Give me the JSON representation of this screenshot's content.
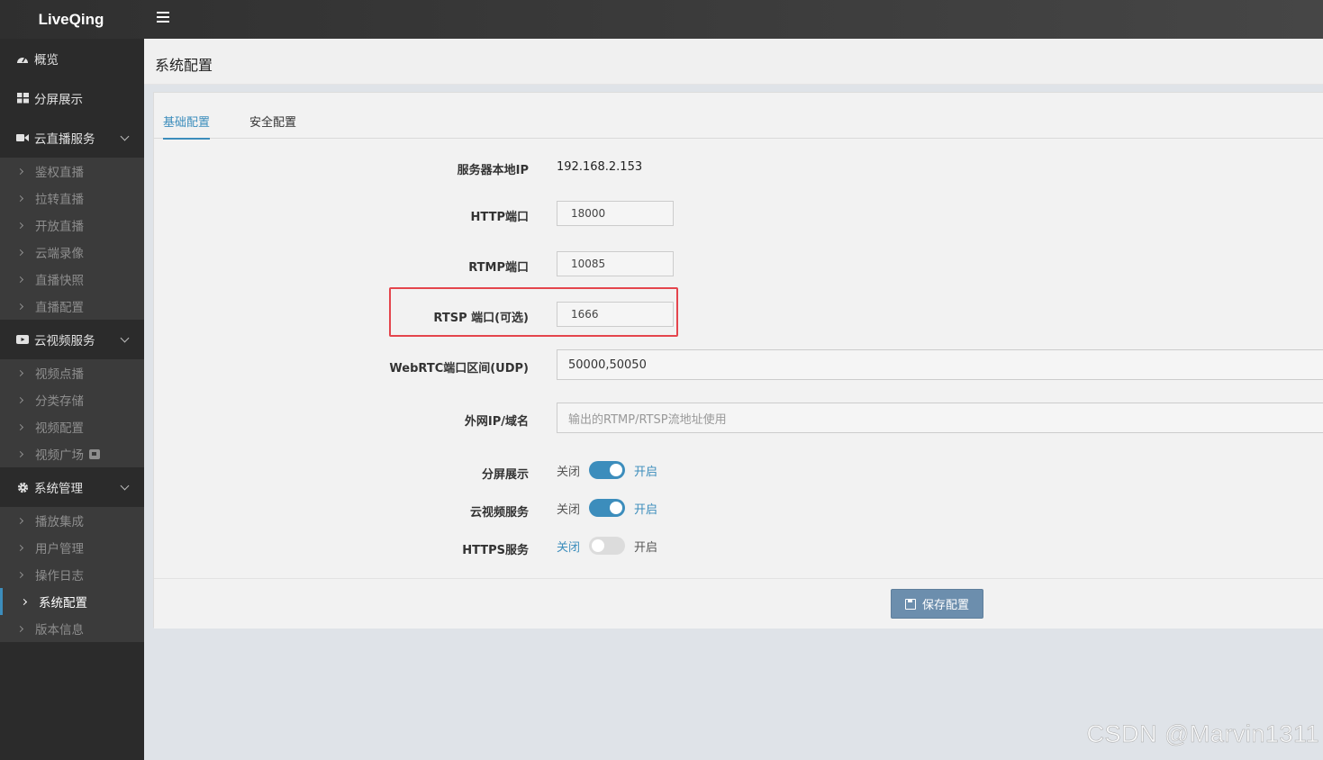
{
  "app": {
    "logo": "LiveQing"
  },
  "sidebar": {
    "items": [
      {
        "label": "概览",
        "icon": "dashboard-icon"
      },
      {
        "label": "分屏展示",
        "icon": "grid-icon"
      },
      {
        "label": "云直播服务",
        "icon": "video-camera-icon",
        "children": [
          "鉴权直播",
          "拉转直播",
          "开放直播",
          "云端录像",
          "直播快照",
          "直播配置"
        ]
      },
      {
        "label": "云视频服务",
        "icon": "youtube-icon",
        "children": [
          "视频点播",
          "分类存储",
          "视频配置",
          "视频广场"
        ]
      },
      {
        "label": "系统管理",
        "icon": "gear-icon",
        "children": [
          "播放集成",
          "用户管理",
          "操作日志",
          "系统配置",
          "版本信息"
        ]
      }
    ],
    "active": "系统配置"
  },
  "page": {
    "title": "系统配置"
  },
  "tabs": [
    {
      "label": "基础配置",
      "active": true
    },
    {
      "label": "安全配置",
      "active": false
    }
  ],
  "form": {
    "server_ip": {
      "label": "服务器本地IP",
      "value": "192.168.2.153"
    },
    "http_port": {
      "label": "HTTP端口",
      "value": "18000"
    },
    "rtmp_port": {
      "label": "RTMP端口",
      "value": "10085"
    },
    "rtsp_port": {
      "label": "RTSP 端口(可选)",
      "value": "1666"
    },
    "webrtc_range": {
      "label": "WebRTC端口区间(UDP)",
      "value": "50000,50050"
    },
    "external_ip": {
      "label": "外网IP/域名",
      "placeholder": "输出的RTMP/RTSP流地址使用"
    },
    "split_screen": {
      "label": "分屏展示",
      "off": "关闭",
      "on": "开启",
      "enabled": true
    },
    "cloud_video": {
      "label": "云视频服务",
      "off": "关闭",
      "on": "开启",
      "enabled": true
    },
    "https": {
      "label": "HTTPS服务",
      "off": "关闭",
      "on": "开启",
      "enabled": false
    }
  },
  "footer": {
    "save_label": "保存配置"
  },
  "watermark": "CSDN @Marvin1311",
  "colors": {
    "accent": "#3c8dbc",
    "highlight": "#e4454d",
    "sidebar": "#2b2b2b",
    "save_button": "#6c8ead"
  }
}
